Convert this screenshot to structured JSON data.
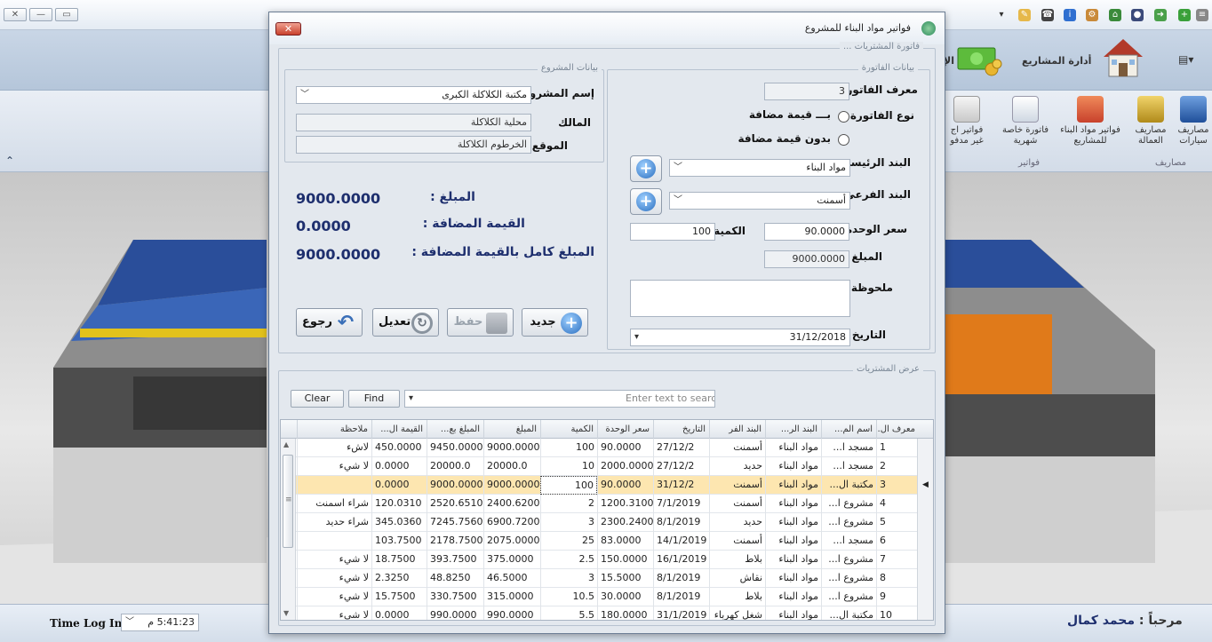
{
  "app": {
    "ribbon_title": "أدارة المشاريع",
    "ribbon_partial": "الإ",
    "groups": {
      "invoices": "فواتير",
      "expenses": "مصاريف"
    },
    "ribbon_items": [
      {
        "label": "مصاريف سيارات",
        "icon": "truck-icon"
      },
      {
        "label": "مصاريف العمالة",
        "icon": "wallet-icon"
      },
      {
        "label": "فواتير مواد البناء للمشاريع",
        "icon": "house-icon"
      },
      {
        "label": "فاتورة خاصة شهرية",
        "icon": "document-icon"
      },
      {
        "label": "فواتير اج غير مدفو",
        "icon": "receipt-icon"
      }
    ]
  },
  "status": {
    "time_log_label": "Time Log In :",
    "time_value": "5:41:23 م",
    "welcome_label": "مرحباً :",
    "user_name": "محمد كمال"
  },
  "dialog": {
    "title": "فواتير مواد البناء للمشروع",
    "purchase_invoice_legend": "فاتورة المشتريات ...",
    "invoice_data": {
      "legend": "بيانات الفاتورة",
      "invoice_id_label": "معرف الفاتورة",
      "invoice_id": "3",
      "invoice_type_label": "نوع الفاتورة",
      "type_with_vat": "بـــ قيمة مضافة",
      "type_without_vat": "بدون قيمة مضافة",
      "main_item_label": "البند الرئيسي",
      "main_item": "مواد البناء",
      "sub_item_label": "البند الفرعي",
      "sub_item": "أسمنت",
      "unit_price_label": "سعر الوحدة",
      "unit_price": "90.0000",
      "quantity_label": "الكمية",
      "quantity": "100",
      "amount_label": "المبلغ",
      "amount": "9000.0000",
      "note_label": "ملحوظة",
      "note": "",
      "date_label": "التاريخ",
      "date": "31/12/2018"
    },
    "project_data": {
      "legend": "بيانات المشروع",
      "project_name_label": "إسم المشروع",
      "project_name": "مكتبة الكلاكلة الكبرى",
      "owner_label": "المالك",
      "owner": "محلية الكلاكلة",
      "location_label": "الموقع",
      "location": "الخرطوم الكلاكلة"
    },
    "summary": {
      "amount_label": "المبلغ :",
      "amount": "9000.0000",
      "vat_label": "القيمة المضافة :",
      "vat": "0.0000",
      "total_label": "المبلغ كامل بالقيمة المضافة :",
      "total": "9000.0000"
    },
    "actions": {
      "new": "جديد",
      "save": "حفظ",
      "edit": "تعديل",
      "back": "رجوع"
    },
    "purchases": {
      "legend": "عرض المشتريات",
      "clear_label": "Clear",
      "find_label": "Find",
      "search_placeholder": "Enter text to search...",
      "columns": [
        "معرف ال...",
        "اسم الم...",
        "البند الر...",
        "البند الفر",
        "التاريخ",
        "سعر الوحدة",
        "الكمية",
        "المبلغ",
        "المبلغ بع...",
        "القيمة ال...",
        "ملاحظة"
      ],
      "rows": [
        [
          "1",
          "مسجد ا...",
          "مواد البناء",
          "أسمنت",
          "27/12/2",
          "90.0000",
          "100",
          "9000.0000",
          "9450.0000",
          "450.0000",
          "لاشء"
        ],
        [
          "2",
          "مسجد ا...",
          "مواد البناء",
          "حديد",
          "27/12/2",
          "2000.0000",
          "10",
          "20000.0",
          "20000.0",
          "0.0000",
          "لا شيء"
        ],
        [
          "3",
          "مكتبة ال...",
          "مواد البناء",
          "أسمنت",
          "31/12/2",
          "90.0000",
          "100",
          "9000.0000",
          "9000.0000",
          "0.0000",
          ""
        ],
        [
          "4",
          "مشروع ا...",
          "مواد البناء",
          "أسمنت",
          "7/1/2019",
          "1200.3100",
          "2",
          "2400.6200",
          "2520.6510",
          "120.0310",
          "شراء اسمنت"
        ],
        [
          "5",
          "مشروع ا...",
          "مواد البناء",
          "حديد",
          "8/1/2019",
          "2300.2400",
          "3",
          "6900.7200",
          "7245.7560",
          "345.0360",
          "شراء حديد"
        ],
        [
          "6",
          "مسجد ا...",
          "مواد البناء",
          "أسمنت",
          "14/1/2019",
          "83.0000",
          "25",
          "2075.0000",
          "2178.7500",
          "103.7500",
          ""
        ],
        [
          "7",
          "مشروع ا...",
          "مواد البناء",
          "بلاط",
          "16/1/2019",
          "150.0000",
          "2.5",
          "375.0000",
          "393.7500",
          "18.7500",
          "لا شيء"
        ],
        [
          "8",
          "مشروع ا...",
          "مواد البناء",
          "نقاش",
          "8/1/2019",
          "15.5000",
          "3",
          "46.5000",
          "48.8250",
          "2.3250",
          "لا شيء"
        ],
        [
          "9",
          "مشروع ا...",
          "مواد البناء",
          "بلاط",
          "8/1/2019",
          "30.0000",
          "10.5",
          "315.0000",
          "330.7500",
          "15.7500",
          "لا شيء"
        ],
        [
          "10",
          "مكتبة ال...",
          "مواد البناء",
          "شغل كهرباء",
          "31/1/2019",
          "180.0000",
          "5.5",
          "990.0000",
          "990.0000",
          "0.0000",
          "لا شيء"
        ]
      ],
      "selected_row": 2
    }
  }
}
